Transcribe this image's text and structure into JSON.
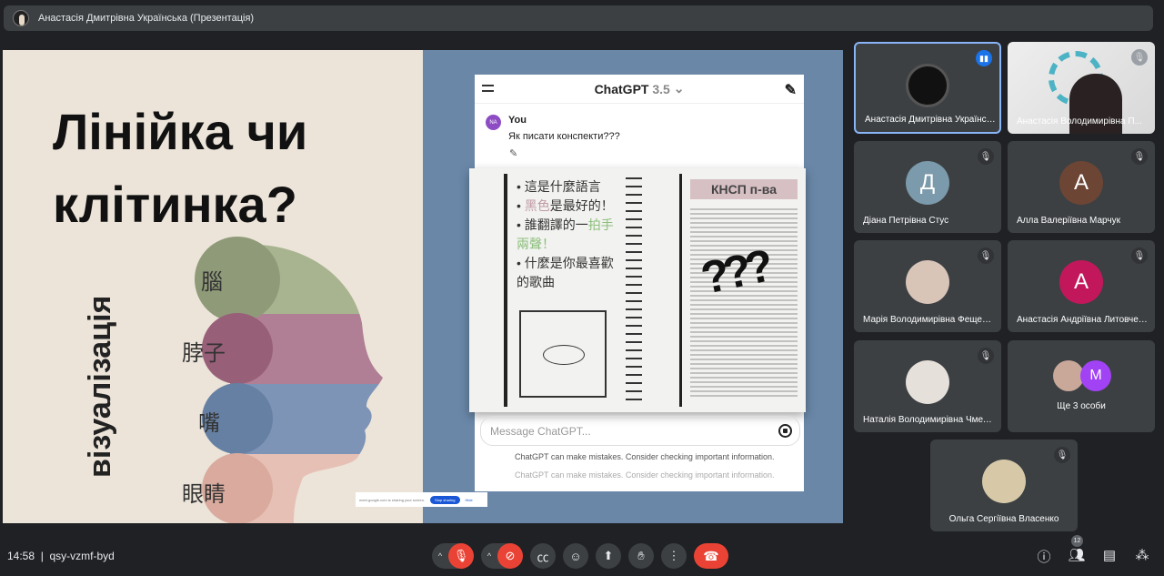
{
  "topbar": {
    "title": "Анастасія Дмитрівна Українська (Презентація)"
  },
  "slide": {
    "title_line1": "Лінійка чи",
    "title_line2": "клітинка?",
    "vertical": "візуалізація",
    "labels": [
      "腦",
      "脖子",
      "嘴",
      "眼睛"
    ],
    "colors": {
      "left_bg": "#ece4d9",
      "right_bg": "#6a87a8"
    },
    "chatgpt": {
      "model": "ChatGPT",
      "version": "3.5",
      "user_initials": "NA",
      "user": "You",
      "question": "Як писати конспекти???",
      "bullets": [
        [
          "這是什麼語言",
          ""
        ],
        [
          "黑色",
          "是最好的！"
        ],
        [
          "誰翻譯的一",
          "拍手兩聲！"
        ],
        [
          "什麼是你最喜歡的歌曲",
          ""
        ]
      ],
      "notebook_title": "КНСП п-ва",
      "marks": "???",
      "placeholder": "Message ChatGPT...",
      "disclaimer": "ChatGPT can make mistakes. Consider checking important information."
    },
    "share_bar": {
      "text": "meet.google.com is sharing your screen.",
      "stop": "Stop sharing",
      "hide": "Hide"
    }
  },
  "participants": [
    {
      "name": "Анастасія Дмитрівна Українська",
      "state": "speaking",
      "avatar": "photo"
    },
    {
      "name": "Анастасія Володимирівна П...",
      "state": "muted",
      "avatar": "video"
    },
    {
      "name": "Діана Петрівна Стус",
      "state": "muted",
      "initial": "Д",
      "color": "#7b9aab"
    },
    {
      "name": "Алла Валеріївна Марчук",
      "state": "muted",
      "initial": "А",
      "color": "#6d4535"
    },
    {
      "name": "Марія Володимирівна Фещенко",
      "state": "muted",
      "avatar": "photo"
    },
    {
      "name": "Анастасія Андріївна Литовченко",
      "state": "muted",
      "initial": "А",
      "color": "#c2185b"
    },
    {
      "name": "Наталія Володимирівна Чмелюк",
      "state": "muted",
      "avatar": "photo"
    },
    {
      "name": "Ще 3 особи",
      "initial": "M",
      "color": "#a142f4"
    },
    {
      "name": "Ольга Сергіївна Власенко",
      "state": "muted",
      "avatar": "photo"
    }
  ],
  "bottom": {
    "time": "14:58",
    "code": "qsy-vzmf-byd",
    "participant_count": "12"
  }
}
